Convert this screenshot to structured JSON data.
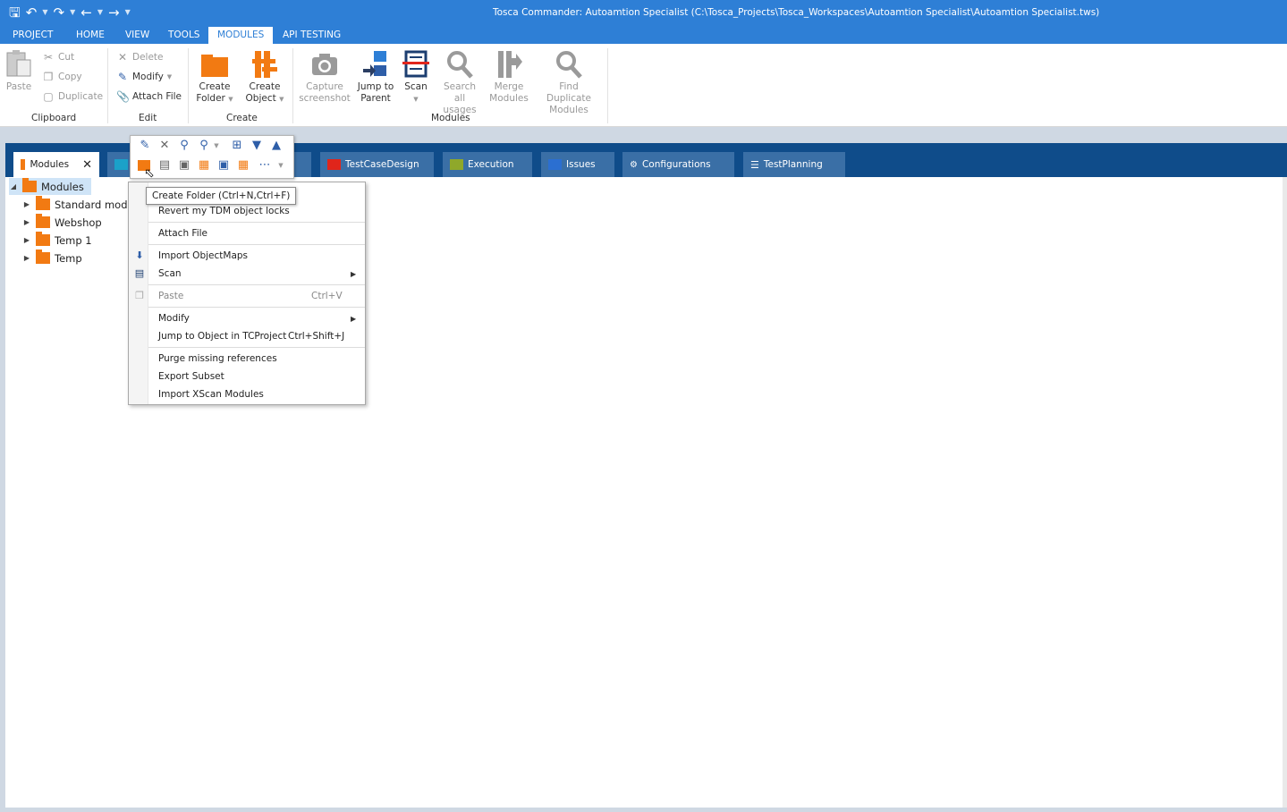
{
  "window": {
    "title": "Tosca Commander: Autoamtion Specialist (C:\\Tosca_Projects\\Tosca_Workspaces\\Autoamtion Specialist\\Autoamtion Specialist.tws)"
  },
  "quick_access": {
    "icons": [
      "save-icon",
      "undo-icon",
      "redo-icon",
      "back-icon",
      "forward-icon"
    ]
  },
  "ribbon_tabs": [
    "PROJECT",
    "HOME",
    "VIEW",
    "TOOLS",
    "MODULES",
    "API TESTING"
  ],
  "active_ribbon_tab": "MODULES",
  "ribbon": {
    "clipboard": {
      "label": "Clipboard",
      "paste": "Paste",
      "cut": "Cut",
      "copy": "Copy",
      "duplicate": "Duplicate"
    },
    "edit": {
      "label": "Edit",
      "delete": "Delete",
      "modify": "Modify",
      "attach_file": "Attach File"
    },
    "create": {
      "label": "Create",
      "folder_l1": "Create",
      "folder_l2": "Folder",
      "object_l1": "Create",
      "object_l2": "Object"
    },
    "modules": {
      "label": "Modules",
      "capture_l1": "Capture",
      "capture_l2": "screenshot",
      "jump_l1": "Jump to",
      "jump_l2": "Parent",
      "scan": "Scan",
      "search_l1": "Search all",
      "search_l2": "usages",
      "merge_l1": "Merge",
      "merge_l2": "Modules",
      "finddup_l1": "Find Duplicate",
      "finddup_l2": "Modules"
    }
  },
  "workspace_tabs": [
    {
      "label": "Modules",
      "color": "#f27a12"
    },
    {
      "label": "TestCaseDesign",
      "color": "#e0251b"
    },
    {
      "label": "Execution",
      "color": "#8fa82a"
    },
    {
      "label": "Issues",
      "color": "#2b6fd1"
    },
    {
      "label": "Configurations",
      "color": "#ffffff"
    },
    {
      "label": "TestPlanning",
      "color": "#ffffff"
    }
  ],
  "tree": {
    "root": "Modules",
    "children": [
      "Standard modu",
      "Webshop",
      "Temp 1",
      "Temp"
    ]
  },
  "tooltip": "Create Folder (Ctrl+N,Ctrl+F)",
  "context_menu": {
    "revert": "Revert my TDM object locks",
    "attach_file": "Attach File",
    "import_objectmaps": "Import ObjectMaps",
    "scan": "Scan",
    "paste": "Paste",
    "paste_shortcut": "Ctrl+V",
    "modify": "Modify",
    "jump": "Jump to Object in TCProject",
    "jump_shortcut": "Ctrl+Shift+J",
    "purge": "Purge missing references",
    "export_subset": "Export Subset",
    "import_xscan": "Import XScan Modules"
  }
}
